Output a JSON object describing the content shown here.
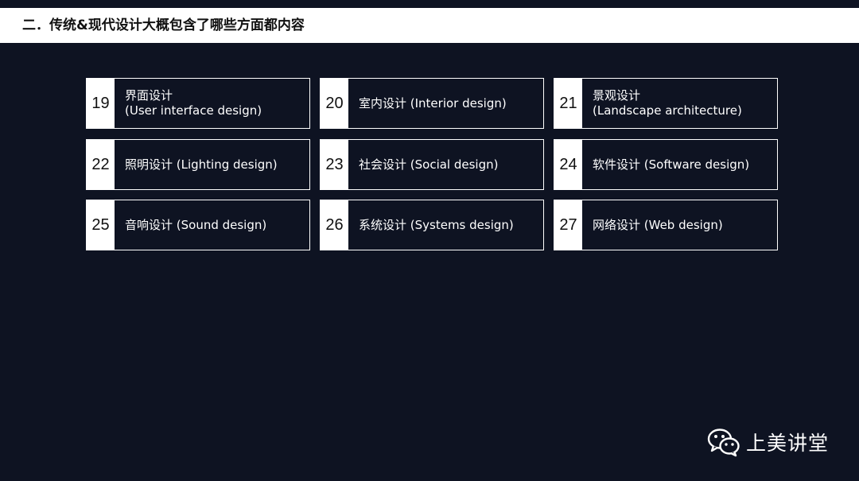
{
  "header": {
    "title": "二．传统&现代设计大概包含了哪些方面都内容"
  },
  "cards": [
    {
      "num": "19",
      "line1": "界面设计",
      "line2": "(User interface design)"
    },
    {
      "num": "20",
      "line1": "室内设计 (Interior design)",
      "line2": ""
    },
    {
      "num": "21",
      "line1": "景观设计",
      "line2": "(Landscape architecture)"
    },
    {
      "num": "22",
      "line1": "照明设计 (Lighting design)",
      "line2": ""
    },
    {
      "num": "23",
      "line1": "社会设计 (Social design)",
      "line2": ""
    },
    {
      "num": "24",
      "line1": "软件设计 (Software design)",
      "line2": ""
    },
    {
      "num": "25",
      "line1": "音响设计 (Sound design)",
      "line2": ""
    },
    {
      "num": "26",
      "line1": "系统设计 (Systems design)",
      "line2": ""
    },
    {
      "num": "27",
      "line1": "网络设计 (Web design)",
      "line2": ""
    }
  ],
  "watermark": {
    "icon": "wechat-icon",
    "text": "上美讲堂"
  }
}
